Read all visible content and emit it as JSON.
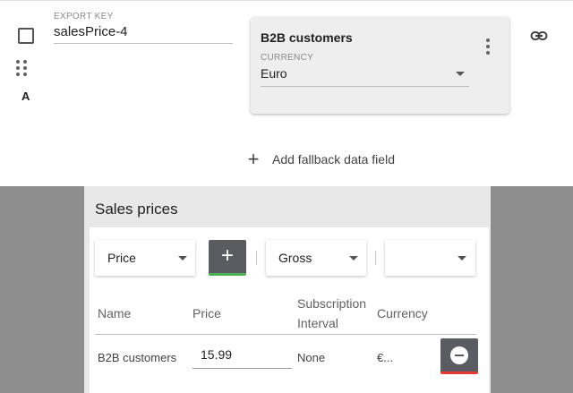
{
  "row": {
    "letter": "A",
    "export_key": {
      "label": "EXPORT KEY",
      "value": "salesPrice-4"
    }
  },
  "card": {
    "title": "B2B customers",
    "currency_label": "CURRENCY",
    "currency_value": "Euro"
  },
  "fallback": {
    "plus_glyph": "+",
    "label": "Add fallback data field"
  },
  "sales": {
    "title": "Sales prices",
    "price_type": "Price",
    "add_glyph": "+",
    "tax_mode": "Gross",
    "third_select": "",
    "headers": {
      "name": "Name",
      "price": "Price",
      "subscription_line1": "Subscription",
      "subscription_line2": "Interval",
      "currency": "Currency"
    },
    "rows": [
      {
        "name": "B2B customers",
        "price": "15.99",
        "interval": "None",
        "currency": "€..."
      }
    ]
  },
  "colors": {
    "add_button_accent": "#4caf50",
    "remove_button_accent": "#e53935",
    "button_bg": "#5b5b62"
  },
  "icons": [
    "checkbox-icon",
    "drag-handle-icon",
    "more-vert-icon",
    "link-icon",
    "plus-icon",
    "chevron-down-icon",
    "remove-circle-icon"
  ]
}
